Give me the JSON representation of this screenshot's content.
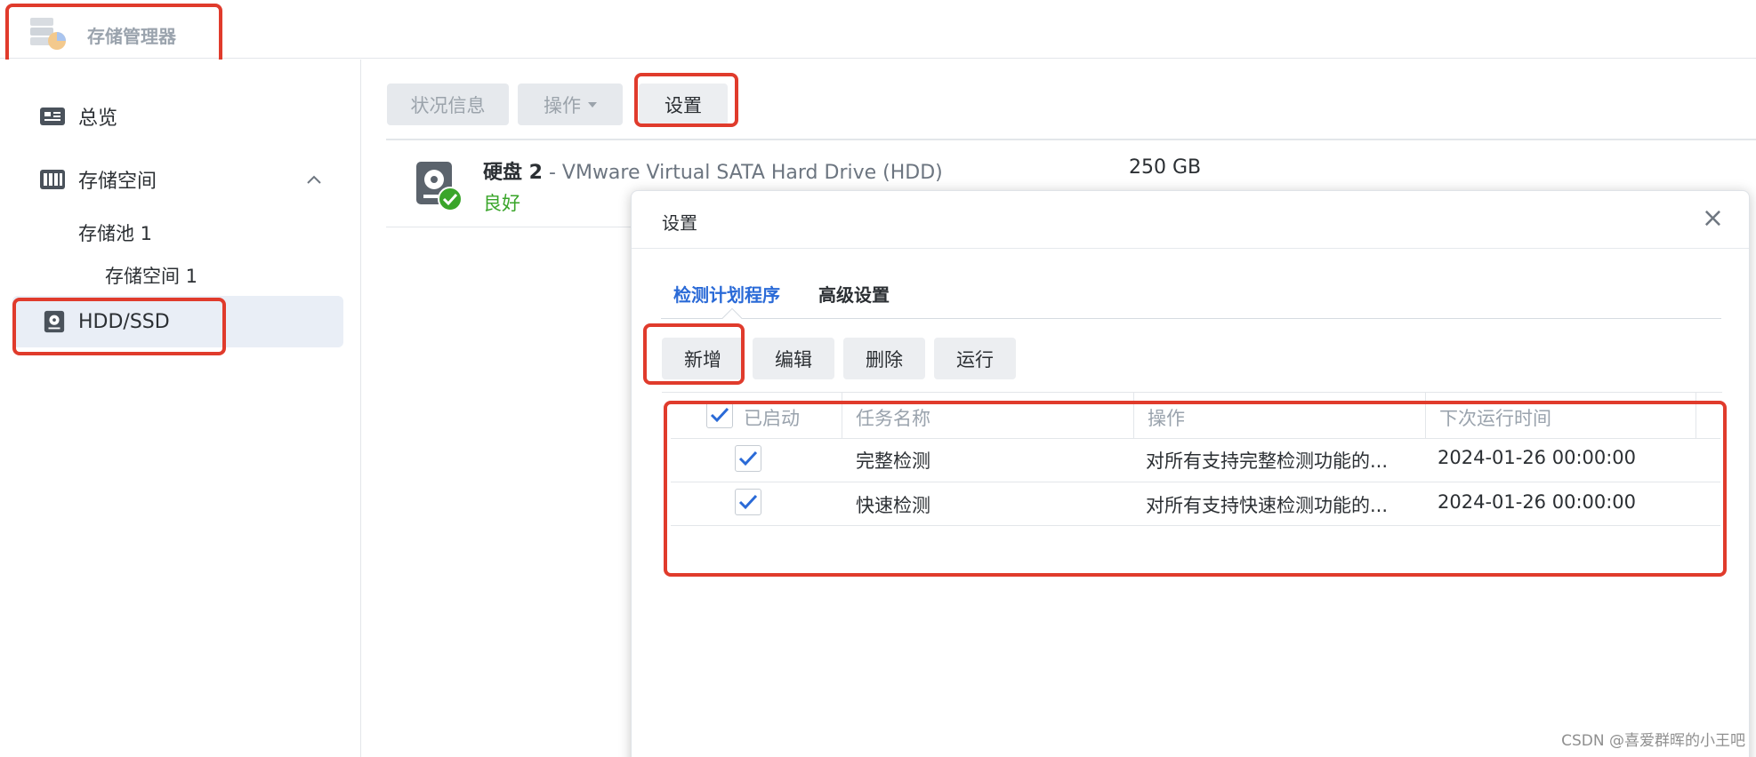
{
  "app": {
    "title": "存储管理器",
    "logo_icon": "storage-manager-icon"
  },
  "sidebar": {
    "items": [
      {
        "label": "总览",
        "icon": "overview-icon"
      },
      {
        "label": "存储空间",
        "icon": "storage-space-icon",
        "expanded": true
      },
      {
        "label": "HDD/SSD",
        "icon": "hdd-icon",
        "active": true
      }
    ],
    "sub_items": [
      {
        "label": "存储池 1"
      },
      {
        "label": "存储空间 1"
      }
    ]
  },
  "toolbar": {
    "status_label": "状况信息",
    "action_label": "操作",
    "settings_label": "设置"
  },
  "disk": {
    "name": "硬盘 2",
    "separator": " - ",
    "model": "VMware Virtual SATA Hard Drive (HDD)",
    "status": "良好",
    "size": "250 GB"
  },
  "dialog": {
    "title": "设置",
    "close_symbol": "×",
    "tabs": [
      {
        "label": "检测计划程序",
        "active": true
      },
      {
        "label": "高级设置",
        "active": false
      }
    ],
    "buttons": {
      "add": "新增",
      "edit": "编辑",
      "delete": "删除",
      "run": "运行"
    },
    "columns": [
      "已启动",
      "任务名称",
      "操作",
      "下次运行时间"
    ],
    "rows": [
      {
        "enabled": true,
        "name": "完整检测",
        "operation": "对所有支持完整检测功能的...",
        "next_run": "2024-01-26 00:00:00"
      },
      {
        "enabled": true,
        "name": "快速检测",
        "operation": "对所有支持快速检测功能的...",
        "next_run": "2024-01-26 00:00:00"
      }
    ]
  },
  "colors": {
    "accent": "#2a6ad7",
    "status_good": "#3aa52a",
    "annotation": "#e03b2c"
  },
  "watermark": "CSDN @喜爱群晖的小王吧"
}
